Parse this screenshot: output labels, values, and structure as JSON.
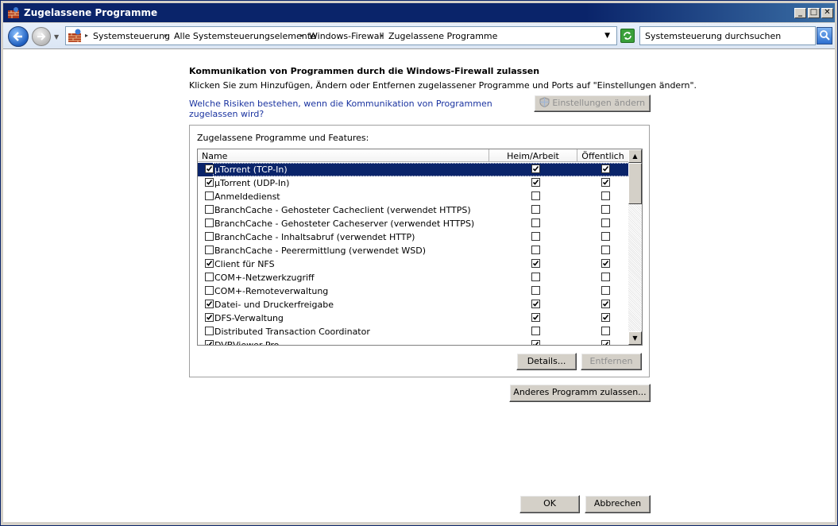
{
  "window": {
    "title": "Zugelassene Programme"
  },
  "breadcrumb": [
    "Systemsteuerung",
    "Alle Systemsteuerungselemente",
    "Windows-Firewall",
    "Zugelassene Programme"
  ],
  "search": {
    "placeholder": "Systemsteuerung durchsuchen"
  },
  "main": {
    "heading": "Kommunikation von Programmen durch die Windows-Firewall zulassen",
    "subtext": "Klicken Sie zum Hinzufügen, Ändern oder Entfernen zugelassener Programme und Ports auf \"Einstellungen ändern\".",
    "risk_link": "Welche Risiken bestehen, wenn die Kommunikation von Programmen zugelassen wird?",
    "change_settings_label": "Einstellungen ändern",
    "group_label": "Zugelassene Programme und Features:",
    "columns": {
      "name": "Name",
      "private": "Heim/Arbeit (Privat)",
      "public": "Öffentlich"
    },
    "rows": [
      {
        "name": "µTorrent (TCP-In)",
        "enabled": true,
        "private": true,
        "public": true,
        "selected": true
      },
      {
        "name": "µTorrent (UDP-In)",
        "enabled": true,
        "private": true,
        "public": true
      },
      {
        "name": "Anmeldedienst",
        "enabled": false,
        "private": false,
        "public": false
      },
      {
        "name": "BranchCache - Gehosteter Cacheclient (verwendet HTTPS)",
        "enabled": false,
        "private": false,
        "public": false
      },
      {
        "name": "BranchCache - Gehosteter Cacheserver (verwendet HTTPS)",
        "enabled": false,
        "private": false,
        "public": false
      },
      {
        "name": "BranchCache - Inhaltsabruf (verwendet HTTP)",
        "enabled": false,
        "private": false,
        "public": false
      },
      {
        "name": "BranchCache - Peerermittlung (verwendet WSD)",
        "enabled": false,
        "private": false,
        "public": false
      },
      {
        "name": "Client für NFS",
        "enabled": true,
        "private": true,
        "public": true
      },
      {
        "name": "COM+-Netzwerkzugriff",
        "enabled": false,
        "private": false,
        "public": false
      },
      {
        "name": "COM+-Remoteverwaltung",
        "enabled": false,
        "private": false,
        "public": false
      },
      {
        "name": "Datei- und Druckerfreigabe",
        "enabled": true,
        "private": true,
        "public": true
      },
      {
        "name": "DFS-Verwaltung",
        "enabled": true,
        "private": true,
        "public": true
      },
      {
        "name": "Distributed Transaction Coordinator",
        "enabled": false,
        "private": false,
        "public": false
      },
      {
        "name": "DVBViewer Pro",
        "enabled": true,
        "private": true,
        "public": true
      }
    ],
    "details_label": "Details...",
    "remove_label": "Entfernen",
    "allow_other_label": "Anderes Programm zulassen...",
    "ok_label": "OK",
    "cancel_label": "Abbrechen"
  }
}
